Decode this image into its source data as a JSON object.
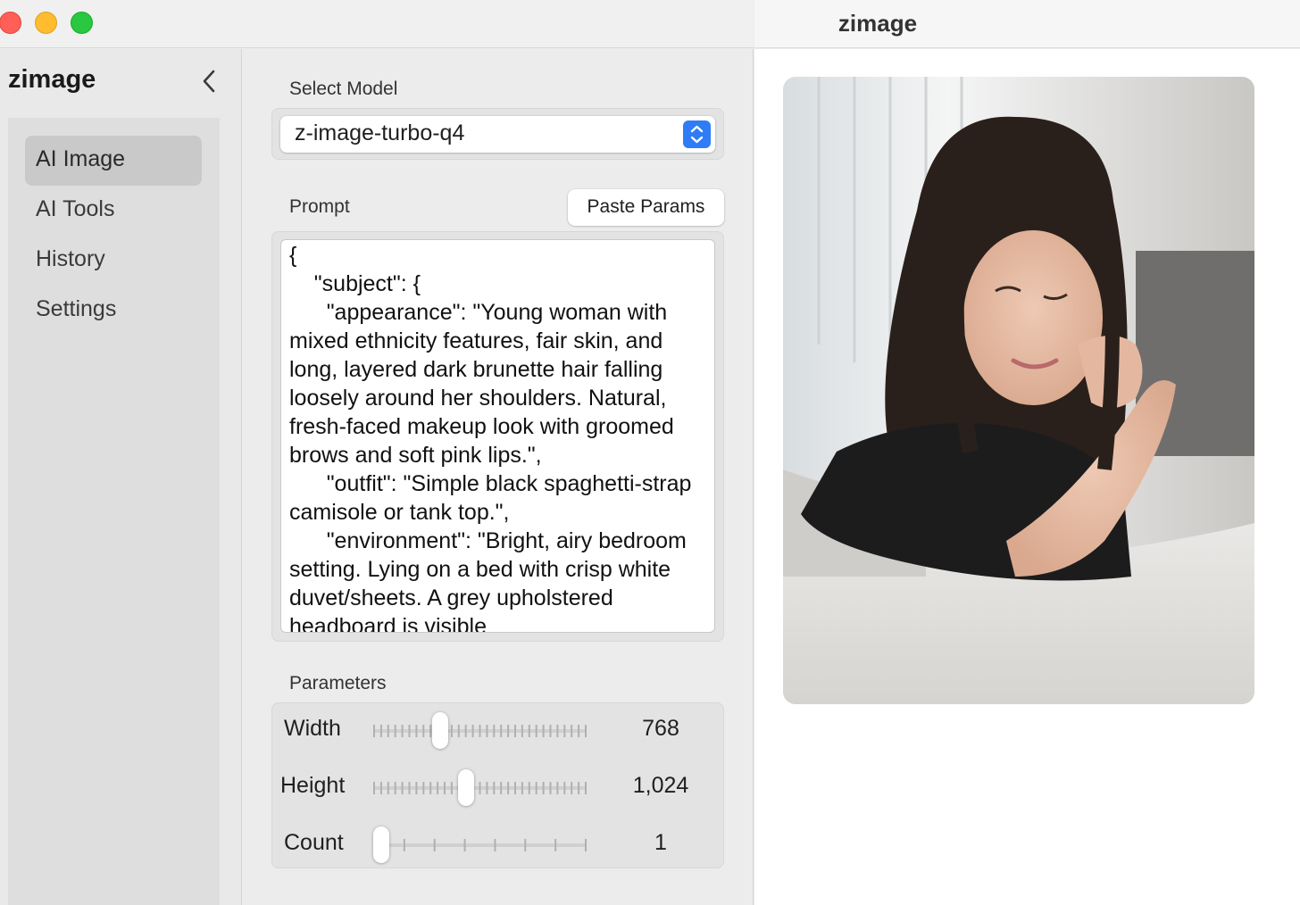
{
  "window": {
    "title": "zimage"
  },
  "sidebar": {
    "title": "zimage",
    "items": [
      {
        "label": "AI Image",
        "active": true
      },
      {
        "label": "AI Tools",
        "active": false
      },
      {
        "label": "History",
        "active": false
      },
      {
        "label": "Settings",
        "active": false
      }
    ]
  },
  "form": {
    "model_label": "Select Model",
    "model_value": "z-image-turbo-q4",
    "prompt_label": "Prompt",
    "paste_button": "Paste Params",
    "prompt_text": "{\n    \"subject\": {\n      \"appearance\": \"Young woman with mixed ethnicity features, fair skin, and long, layered dark brunette hair falling loosely around her shoulders. Natural, fresh-faced makeup look with groomed brows and soft pink lips.\",\n      \"outfit\": \"Simple black spaghetti-strap camisole or tank top.\",\n      \"environment\": \"Bright, airy bedroom setting. Lying on a bed with crisp white duvet/sheets. A grey upholstered headboard is visible",
    "parameters_label": "Parameters",
    "params": [
      {
        "label": "Width",
        "value": "768",
        "fraction": 0.3
      },
      {
        "label": "Height",
        "value": "1,024",
        "fraction": 0.43
      },
      {
        "label": "Count",
        "value": "1",
        "fraction": 0.0
      }
    ]
  },
  "colors": {
    "accent": "#2f7cf6",
    "sidebar_active": "#c9c9c9"
  },
  "icons": {
    "collapse": "chevron-left-icon",
    "stepper": "up-down-chevron-icon"
  }
}
